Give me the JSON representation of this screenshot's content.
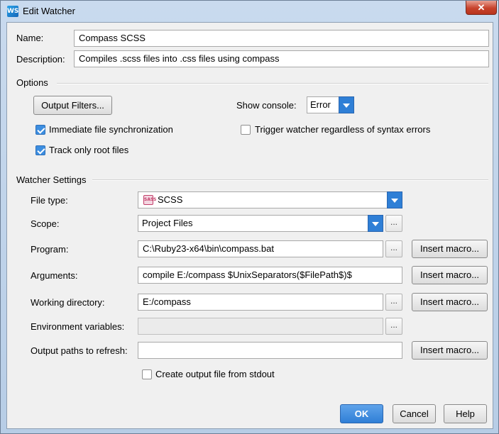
{
  "window": {
    "title": "Edit Watcher",
    "app_icon": "WS",
    "close_glyph": "✕"
  },
  "name": {
    "label": "Name:",
    "value": "Compass SCSS"
  },
  "description": {
    "label": "Description:",
    "value": "Compiles .scss files into .css files using compass"
  },
  "options": {
    "section_title": "Options",
    "output_filters_label": "Output Filters...",
    "show_console_label": "Show console:",
    "show_console_value": "Error",
    "immediate_sync": {
      "label": "Immediate file synchronization",
      "checked": true
    },
    "trigger_watcher": {
      "label": "Trigger watcher regardless of syntax errors",
      "checked": false
    },
    "track_root": {
      "label": "Track only root files",
      "checked": true
    }
  },
  "watcher": {
    "section_title": "Watcher Settings",
    "file_type": {
      "label": "File type:",
      "value": "SCSS",
      "icon_text": "SASS"
    },
    "scope": {
      "label": "Scope:",
      "value": "Project Files"
    },
    "program": {
      "label": "Program:",
      "value": "C:\\Ruby23-x64\\bin\\compass.bat"
    },
    "arguments": {
      "label": "Arguments:",
      "value": "compile E:/compass $UnixSeparators($FilePath$)$"
    },
    "working_dir": {
      "label": "Working directory:",
      "value": "E:/compass"
    },
    "env_vars": {
      "label": "Environment variables:",
      "value": ""
    },
    "output_paths": {
      "label": "Output paths to refresh:",
      "value": ""
    },
    "create_output": {
      "label": "Create output file from stdout",
      "checked": false
    },
    "insert_macro_label": "Insert macro...",
    "browse_label": "..."
  },
  "footer": {
    "ok_label": "OK",
    "cancel_label": "Cancel",
    "help_label": "Help"
  },
  "colors": {
    "accent": "#2f7fd6",
    "window_frame": "#b7cde6",
    "close_button": "#c7432c"
  }
}
